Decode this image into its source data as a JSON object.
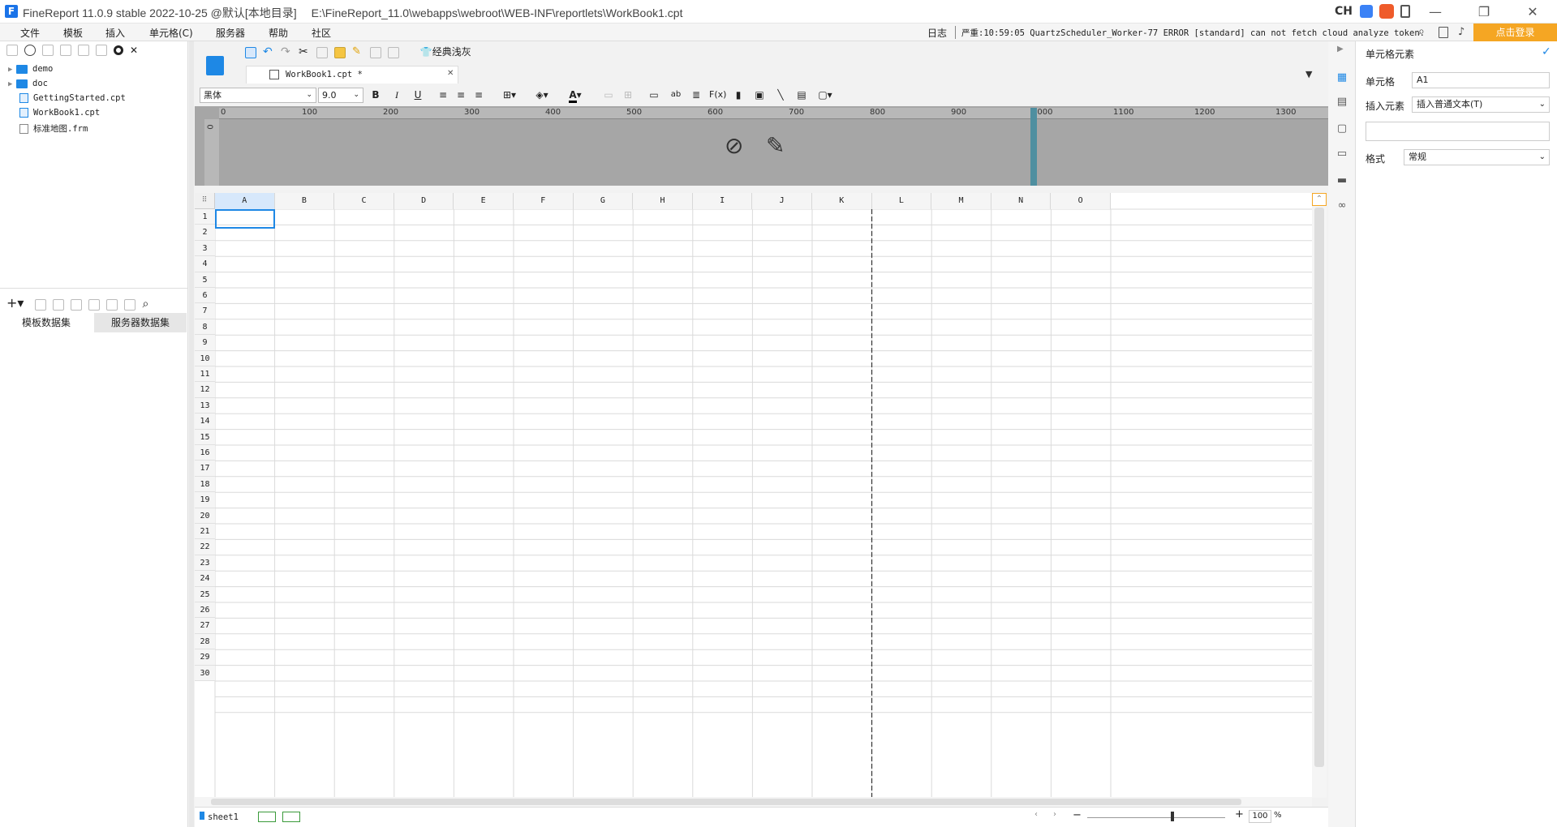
{
  "window": {
    "app_logo": "F",
    "product": "FineReport 11.0.9 stable 2022-10-25 @默认[本地目录]",
    "path": "E:\\FineReport_11.0\\webapps\\webroot\\WEB-INF\\reportlets\\WorkBook1.cpt",
    "ime": "CH",
    "minimize": "—",
    "restore": "❐",
    "close": "✕"
  },
  "menu": [
    "文件",
    "模板",
    "插入",
    "单元格(C)",
    "服务器",
    "帮助",
    "社区"
  ],
  "status": {
    "log_label": "日志",
    "message": "严重:10:59:05 QuartzScheduler_Worker-77 ERROR [standard] can not fetch cloud analyze token.",
    "login_button": "点击登录"
  },
  "file_tree": [
    {
      "type": "folder",
      "name": "demo"
    },
    {
      "type": "folder",
      "name": "doc"
    },
    {
      "type": "file",
      "name": "GettingStarted.cpt"
    },
    {
      "type": "file",
      "name": "WorkBook1.cpt"
    },
    {
      "type": "file",
      "name": "标准地图.frm"
    }
  ],
  "dataset_tabs": [
    "模板数据集",
    "服务器数据集"
  ],
  "toolbar": {
    "theme_button": "经典浅灰"
  },
  "doc_tab": {
    "name": "WorkBook1.cpt *",
    "close": "✕"
  },
  "format": {
    "font_name": "黑体",
    "font_size": "9.0",
    "bold": "B",
    "italic": "I",
    "underline": "U"
  },
  "ruler": {
    "ticks": [
      "0",
      "100",
      "200",
      "300",
      "400",
      "500",
      "600",
      "700",
      "800",
      "900",
      "1000",
      "1100",
      "1200",
      "1300"
    ]
  },
  "grid": {
    "columns": [
      "A",
      "B",
      "C",
      "D",
      "E",
      "F",
      "G",
      "H",
      "I",
      "J",
      "K",
      "L",
      "M",
      "N",
      "O"
    ],
    "rows": [
      "1",
      "2",
      "3",
      "4",
      "5",
      "6",
      "7",
      "8",
      "9",
      "10",
      "11",
      "12",
      "13",
      "14",
      "15",
      "16",
      "17",
      "18",
      "19",
      "20",
      "21",
      "22",
      "23",
      "24",
      "25",
      "26",
      "27",
      "28",
      "29",
      "30"
    ],
    "selected_cell": "A1"
  },
  "sheet": {
    "name": "sheet1",
    "zoom": "100",
    "zoom_unit": "%"
  },
  "right_panel": {
    "title": "单元格元素",
    "cell_label": "单元格",
    "cell_value": "A1",
    "insert_label": "插入元素",
    "insert_value": "插入普通文本(T)",
    "format_label": "格式",
    "format_value": "常规"
  },
  "colors": {
    "accent": "#1e88e5",
    "login_orange": "#f5a623",
    "selected_col_header": "#d7e8fb",
    "ruler_bg": "#a6a6a6"
  }
}
